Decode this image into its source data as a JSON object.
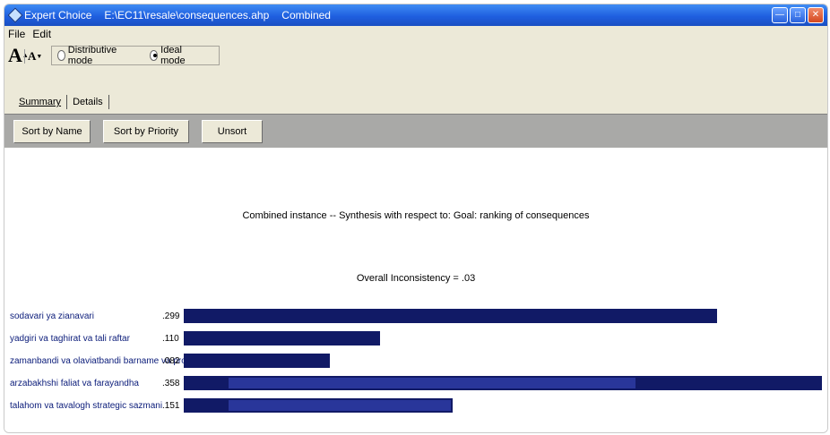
{
  "window": {
    "app_name": "Expert Choice",
    "file_path": "E:\\EC11\\resale\\consequences.ahp",
    "instance": "Combined"
  },
  "menu": {
    "items": [
      "File",
      "Edit"
    ]
  },
  "toolbar": {
    "font_large_label": "A",
    "font_small_label": "A",
    "distributive_label": "Distributive mode",
    "ideal_label": "Ideal mode",
    "selected_mode": "Ideal mode"
  },
  "tabs": [
    {
      "label": "Summary",
      "active": true
    },
    {
      "label": "Details",
      "active": false
    }
  ],
  "sort_buttons": {
    "by_name": "Sort by Name",
    "by_priority": "Sort by Priority",
    "unsort": "Unsort"
  },
  "synthesis": {
    "title": "Combined instance -- Synthesis with respect to: Goal: ranking of consequences",
    "inconsistency": "Overall Inconsistency = .03",
    "bar_color": "#111a66",
    "rows": [
      {
        "label": "sodavari ya zianavari",
        "value_text": ".299",
        "value": 0.299
      },
      {
        "label": "yadgiri va taghirat va tali raftar",
        "value_text": ".110",
        "value": 0.11
      },
      {
        "label": "zamanbandi va olaviatbandi barname va proje",
        "value_text": ".082",
        "value": 0.082
      },
      {
        "label": "arzabakhshi faliat va farayandha",
        "value_text": ".358",
        "value": 0.358
      },
      {
        "label": "talahom va tavalogh strategic sazmani",
        "value_text": ".151",
        "value": 0.151
      }
    ]
  }
}
